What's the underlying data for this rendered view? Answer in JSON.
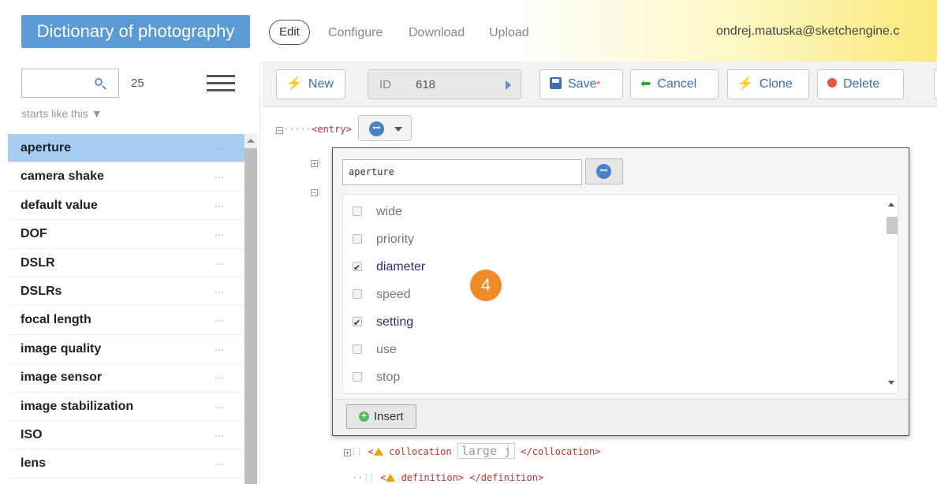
{
  "header": {
    "app_title": "Dictionary of photography",
    "edit_label": "Edit",
    "configure_label": "Configure",
    "download_label": "Download",
    "upload_label": "Upload",
    "user": "ondrej.matuska@sketchengine.c"
  },
  "sidebar": {
    "search_value": "",
    "count": "25",
    "filter_mode": "starts like this ▼",
    "entries": [
      {
        "label": "aperture",
        "selected": true
      },
      {
        "label": "camera shake"
      },
      {
        "label": "default value"
      },
      {
        "label": "DOF"
      },
      {
        "label": "DSLR"
      },
      {
        "label": "DSLRs"
      },
      {
        "label": "focal length"
      },
      {
        "label": "image quality"
      },
      {
        "label": "image sensor"
      },
      {
        "label": "image stabilization"
      },
      {
        "label": "ISO"
      },
      {
        "label": "lens"
      }
    ],
    "dots": "···"
  },
  "toolbar": {
    "new_label": "New",
    "id_label": "ID",
    "id_value": "618",
    "save_label": "Save",
    "save_marker": "*",
    "cancel_label": "Cancel",
    "clone_label": "Clone",
    "delete_label": "Delete"
  },
  "editor": {
    "entry_tag": "<entry>",
    "collocation_open": "<",
    "collocation_tag": "collocation",
    "collocation_value": "large j",
    "collocation_close": "</collocation>",
    "definition_tag": "definition",
    "definition_close": "</definition>"
  },
  "popup": {
    "search_value": "aperture",
    "options": [
      {
        "label": "wide",
        "checked": false
      },
      {
        "label": "priority",
        "checked": false
      },
      {
        "label": "diameter",
        "checked": true
      },
      {
        "label": "speed",
        "checked": false
      },
      {
        "label": "setting",
        "checked": true
      },
      {
        "label": "use",
        "checked": false
      },
      {
        "label": "stop",
        "checked": false
      }
    ],
    "insert_label": "Insert"
  },
  "badge": "4",
  "colors": {
    "accent": "#5b9bd5",
    "selected_row": "#a8cdf3",
    "badge": "#f08a24"
  }
}
